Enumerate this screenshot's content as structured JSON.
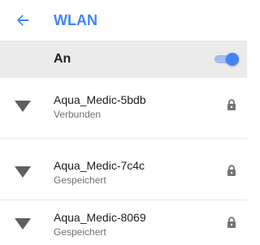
{
  "header": {
    "title": "WLAN",
    "back_icon": "arrow-back-icon"
  },
  "master_switch": {
    "label": "An",
    "state": "on"
  },
  "networks": [
    {
      "name": "Aqua_Medic-5bdb",
      "status": "Verbunden",
      "secured": true,
      "icon": "wifi-signal-icon"
    },
    {
      "name": "Aqua_Medic-7c4c",
      "status": "Gespeichert",
      "secured": true,
      "icon": "wifi-signal-icon"
    },
    {
      "name": "Aqua_Medic-8069",
      "status": "Gespeichert",
      "secured": true,
      "icon": "wifi-signal-icon"
    }
  ],
  "colors": {
    "accent": "#4285f4",
    "master_row_bg": "#ebebeb",
    "icon": "#5f5f5f",
    "lock": "#757575"
  }
}
